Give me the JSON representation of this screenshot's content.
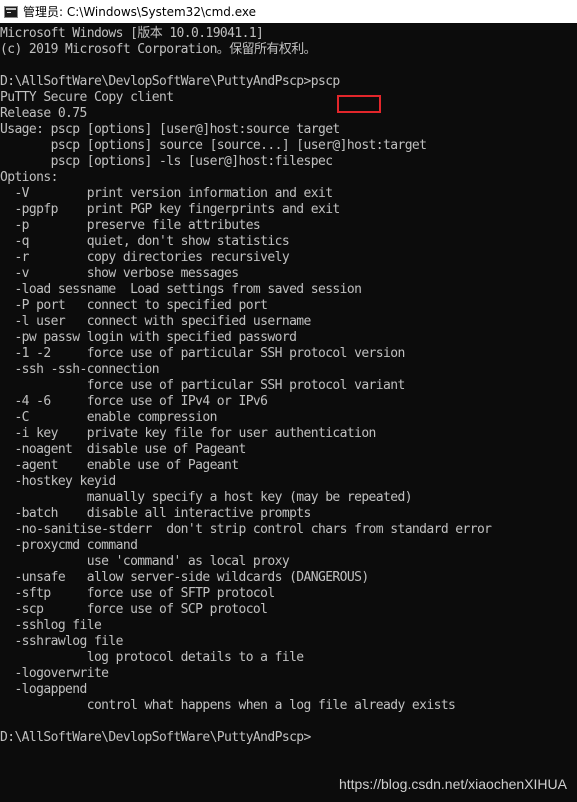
{
  "window": {
    "title": "管理员: C:\\Windows\\System32\\cmd.exe",
    "icon": "console-icon"
  },
  "console": {
    "text_color": "#c0c0c0",
    "background": "#0c0c0c",
    "highlight_color": "#e3262b",
    "lines": [
      "Microsoft Windows [版本 10.0.19041.1]",
      "(c) 2019 Microsoft Corporation。保留所有权利。",
      "",
      "D:\\AllSoftWare\\DevlopSoftWare\\PuttyAndPscp>pscp",
      "PuTTY Secure Copy client",
      "Release 0.75",
      "Usage: pscp [options] [user@]host:source target",
      "       pscp [options] source [source...] [user@]host:target",
      "       pscp [options] -ls [user@]host:filespec",
      "Options:",
      "  -V        print version information and exit",
      "  -pgpfp    print PGP key fingerprints and exit",
      "  -p        preserve file attributes",
      "  -q        quiet, don't show statistics",
      "  -r        copy directories recursively",
      "  -v        show verbose messages",
      "  -load sessname  Load settings from saved session",
      "  -P port   connect to specified port",
      "  -l user   connect with specified username",
      "  -pw passw login with specified password",
      "  -1 -2     force use of particular SSH protocol version",
      "  -ssh -ssh-connection",
      "            force use of particular SSH protocol variant",
      "  -4 -6     force use of IPv4 or IPv6",
      "  -C        enable compression",
      "  -i key    private key file for user authentication",
      "  -noagent  disable use of Pageant",
      "  -agent    enable use of Pageant",
      "  -hostkey keyid",
      "            manually specify a host key (may be repeated)",
      "  -batch    disable all interactive prompts",
      "  -no-sanitise-stderr  don't strip control chars from standard error",
      "  -proxycmd command",
      "            use 'command' as local proxy",
      "  -unsafe   allow server-side wildcards (DANGEROUS)",
      "  -sftp     force use of SFTP protocol",
      "  -scp      force use of SCP protocol",
      "  -sshlog file",
      "  -sshrawlog file",
      "            log protocol details to a file",
      "  -logoverwrite",
      "  -logappend",
      "            control what happens when a log file already exists",
      "",
      "D:\\AllSoftWare\\DevlopSoftWare\\PuttyAndPscp>"
    ]
  },
  "watermark": "https://blog.csdn.net/xiaochenXIHUA"
}
